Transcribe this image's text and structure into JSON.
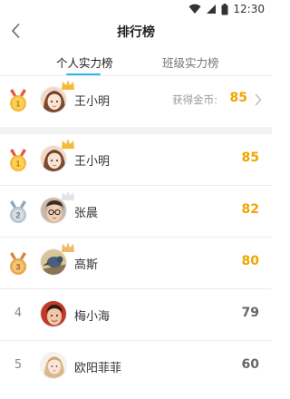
{
  "status_bar": {
    "time": "12:30"
  },
  "nav": {
    "title": "排行榜"
  },
  "tabs": [
    {
      "label": "个人实力榜",
      "active": true
    },
    {
      "label": "班级实力榜",
      "active": false
    }
  ],
  "my_rank": {
    "rank": 1,
    "name": "王小明",
    "coin_label": "获得金币:",
    "score": "85"
  },
  "rankings": [
    {
      "rank": "1",
      "name": "王小明",
      "score": "85",
      "medal": "gold"
    },
    {
      "rank": "2",
      "name": "张晨",
      "score": "82",
      "medal": "silver"
    },
    {
      "rank": "3",
      "name": "高斯",
      "score": "80",
      "medal": "bronze"
    },
    {
      "rank": "4",
      "name": "梅小海",
      "score": "79",
      "medal": "none"
    },
    {
      "rank": "5",
      "name": "欧阳菲菲",
      "score": "60",
      "medal": "none"
    }
  ],
  "colors": {
    "accent": "#29b6f6",
    "gold": "#f0a500",
    "silver": "#b9c3cc",
    "bronze": "#e9a64a"
  }
}
